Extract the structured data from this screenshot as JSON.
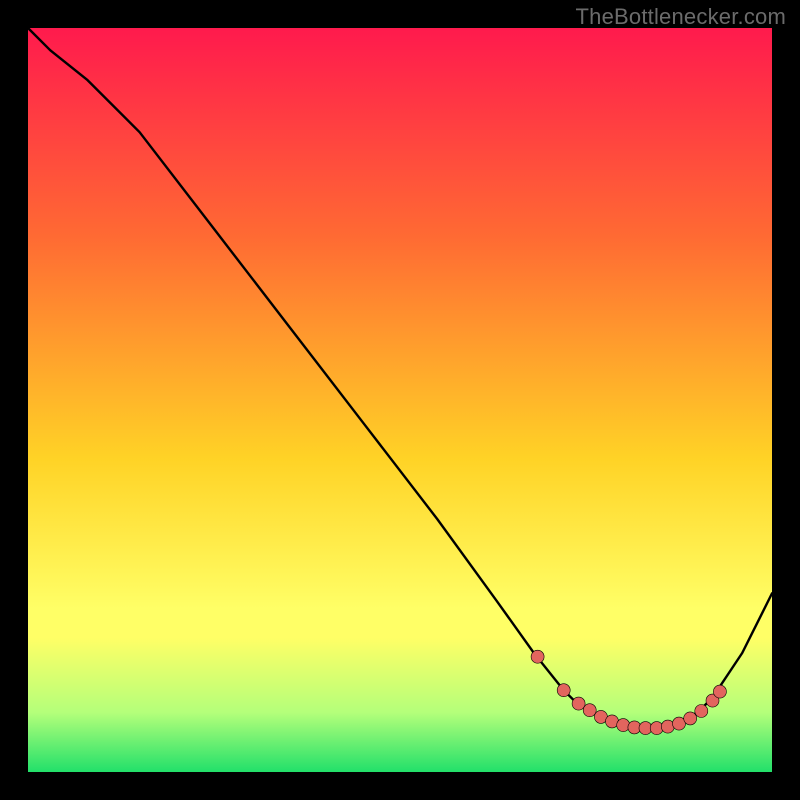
{
  "watermark": "TheBottlenecker.com",
  "colors": {
    "black": "#000000",
    "curve_stroke": "#000000",
    "marker_fill": "#e2655e",
    "marker_edge": "#000000",
    "grad_top": "#ff1a4d",
    "grad_upper": "#ff6a33",
    "grad_mid": "#ffd326",
    "grad_yellowband": "#ffff66",
    "grad_lightgreen": "#b4ff7a",
    "grad_green": "#22e06a"
  },
  "chart_data": {
    "type": "line",
    "title": "",
    "xlabel": "",
    "ylabel": "",
    "xlim": [
      0,
      100
    ],
    "ylim": [
      0,
      100
    ],
    "background": "vertical-gradient (red→yellow→green)",
    "series": [
      {
        "name": "bottleneck-curve",
        "x": [
          0,
          3,
          8,
          15,
          25,
          35,
          45,
          55,
          63,
          68,
          72,
          74,
          76,
          78,
          80,
          82,
          84,
          86,
          88,
          90,
          92,
          96,
          100
        ],
        "y": [
          100,
          97,
          93,
          86,
          73,
          60,
          47,
          34,
          23,
          16,
          11,
          9,
          8,
          7,
          6,
          6,
          6,
          6,
          7,
          8,
          10,
          16,
          24
        ]
      }
    ],
    "markers": {
      "name": "optimal-range-points",
      "x": [
        68.5,
        72,
        74,
        75.5,
        77,
        78.5,
        80,
        81.5,
        83,
        84.5,
        86,
        87.5,
        89,
        90.5,
        92,
        93
      ],
      "y": [
        15.5,
        11,
        9.2,
        8.3,
        7.4,
        6.8,
        6.3,
        6.0,
        5.9,
        5.9,
        6.1,
        6.5,
        7.2,
        8.2,
        9.6,
        10.8
      ]
    }
  }
}
